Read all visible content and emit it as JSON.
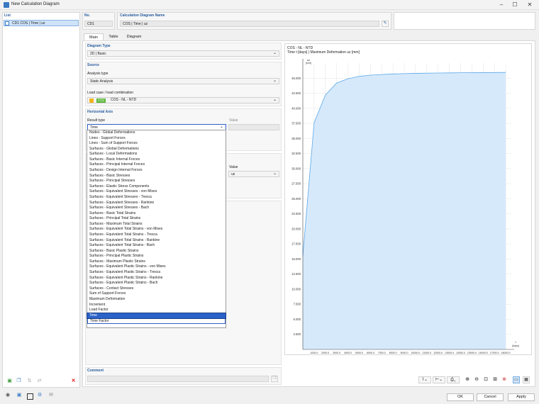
{
  "window": {
    "title": "New Calculation Diagram",
    "controls": [
      "–",
      "☐",
      "✕"
    ]
  },
  "list": {
    "header": "List",
    "items": [
      {
        "label": "CD1  COS | Time | uz"
      }
    ]
  },
  "header": {
    "no_label": "No.",
    "no_value": "CD1",
    "name_label": "Calculation Diagram Name",
    "name_value": "COS | Time | uz"
  },
  "tabs": [
    {
      "label": "Main"
    },
    {
      "label": "Table"
    },
    {
      "label": "Diagram"
    }
  ],
  "main": {
    "diagram_type": {
      "label": "Diagram Type",
      "value": "2D | Basic"
    },
    "source": {
      "label": "Source",
      "analysis_type_label": "Analysis type",
      "analysis_type_value": "Static Analysis",
      "load_label": "Load case / load combination",
      "load_badge": "CO1",
      "load_value": "COS - NL - NTD"
    },
    "horizontal_axis": {
      "label": "Horizontal Axis",
      "result_type_label": "Result type",
      "result_type_value": "Time",
      "value_label": "Value"
    },
    "vertical_axis": {
      "value_label": "Value",
      "value_value": "uz"
    },
    "comment_label": "Comment"
  },
  "dropdown_items": [
    "Nodes - Global Deformations",
    "Lines - Support Forces",
    "Lines - Sum of Support Forces",
    "Surfaces - Global Deformations",
    "Surfaces - Local Deformations",
    "Surfaces - Basic Internal Forces",
    "Surfaces - Principal Internal Forces",
    "Surfaces - Design Internal Forces",
    "Surfaces - Basic Stresses",
    "Surfaces - Principal Stresses",
    "Surfaces - Elastic Stress Components",
    "Surfaces - Equivalent Stresses - von Mises",
    "Surfaces - Equivalent Stresses - Tresca",
    "Surfaces - Equivalent Stresses - Rankine",
    "Surfaces - Equivalent Stresses - Bach",
    "Surfaces - Basic Total Strains",
    "Surfaces - Principal Total Strains",
    "Surfaces - Maximum Total Strains",
    "Surfaces - Equivalent Total Strains - von Mises",
    "Surfaces - Equivalent Total Strains - Tresca",
    "Surfaces - Equivalent Total Strains - Rankine",
    "Surfaces - Equivalent Total Strains - Bach",
    "Surfaces - Basic Plastic Strains",
    "Surfaces - Principal Plastic Strains",
    "Surfaces - Maximum Plastic Strains",
    "Surfaces - Equivalent Plastic Strains - von Mises",
    "Surfaces - Equivalent Plastic Strains - Tresca",
    "Surfaces - Equivalent Plastic Strains - Rankine",
    "Surfaces - Equivalent Plastic Strains - Bach",
    "Surfaces - Contact Stresses",
    "Sum of Support Forces",
    "Maximum Deformation",
    "Increment",
    "Load Factor",
    "Time",
    "Time Factor"
  ],
  "dropdown_selected": "Time",
  "chart_header": {
    "line1": "COS - NL - NTD",
    "line2": "Time t [days] | Maximum Deformation uz [mm]"
  },
  "chart_data": {
    "type": "area",
    "ylabel": "uz\n[mm]",
    "xlabel": "t\n[days]",
    "yticks": [
      "45.000",
      "42.500",
      "40.000",
      "37.500",
      "35.000",
      "32.500",
      "30.000",
      "27.500",
      "25.000",
      "22.500",
      "20.000",
      "17.500",
      "15.000",
      "12.500",
      "10.000",
      "7.500",
      "5.000",
      "2.500"
    ],
    "ylim": [
      0,
      47.5
    ],
    "xticks": [
      "1000.0",
      "2000.0",
      "3000.0",
      "4000.0",
      "5000.0",
      "6000.0",
      "7000.0",
      "8000.0",
      "9000.0",
      "10000.0",
      "11000.0",
      "12000.0",
      "13000.0",
      "14000.0",
      "15000.0",
      "16000.0",
      "17000.0",
      "18000.0"
    ],
    "xlim": [
      0,
      18500
    ],
    "x": [
      0,
      1000,
      2000,
      3000,
      4000,
      5000,
      6000,
      7000,
      8000,
      9000,
      10000,
      12000,
      14000,
      16000,
      18000
    ],
    "y": [
      15.5,
      37.6,
      42.2,
      44.2,
      44.9,
      45.3,
      45.5,
      45.6,
      45.7,
      45.75,
      45.8,
      45.85,
      45.9,
      45.92,
      45.95
    ],
    "grid": true,
    "fill_color": "#d6e9fb",
    "line_color": "#5aa8e8"
  },
  "footer": {
    "ok": "OK",
    "cancel": "Cancel",
    "apply": "Apply"
  },
  "colors": {
    "accent": "#2a5d9f",
    "selection": "#2a62c8",
    "badge": "#5cb83a"
  }
}
